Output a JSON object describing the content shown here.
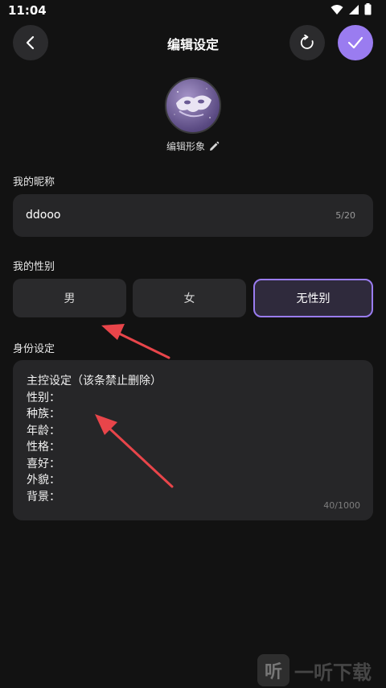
{
  "status_bar": {
    "time": "11:04",
    "icons": [
      "wifi-icon",
      "signal-icon",
      "battery-icon"
    ]
  },
  "header": {
    "title": "编辑设定",
    "back_icon": "chevron-left-icon",
    "reset_icon": "refresh-icon",
    "confirm_icon": "check-icon"
  },
  "avatar": {
    "edit_label": "编辑形象",
    "edit_icon": "pencil-icon"
  },
  "nickname": {
    "label": "我的昵称",
    "value": "ddooo",
    "count": "5/20"
  },
  "gender": {
    "label": "我的性别",
    "options": [
      "男",
      "女",
      "无性别"
    ],
    "selected": "无性别"
  },
  "identity": {
    "label": "身份设定",
    "lines": [
      "主控设定（该条禁止删除）",
      "性别：",
      "种族：",
      "年龄：",
      "性格：",
      "喜好：",
      "外貌：",
      "背景："
    ],
    "count": "40/1000"
  },
  "watermark": {
    "text": "一听下载",
    "logo_glyph": "听"
  },
  "colors": {
    "background": "#121212",
    "field": "#262628",
    "accent": "#9a7cf0",
    "arrow": "#e8454a"
  }
}
